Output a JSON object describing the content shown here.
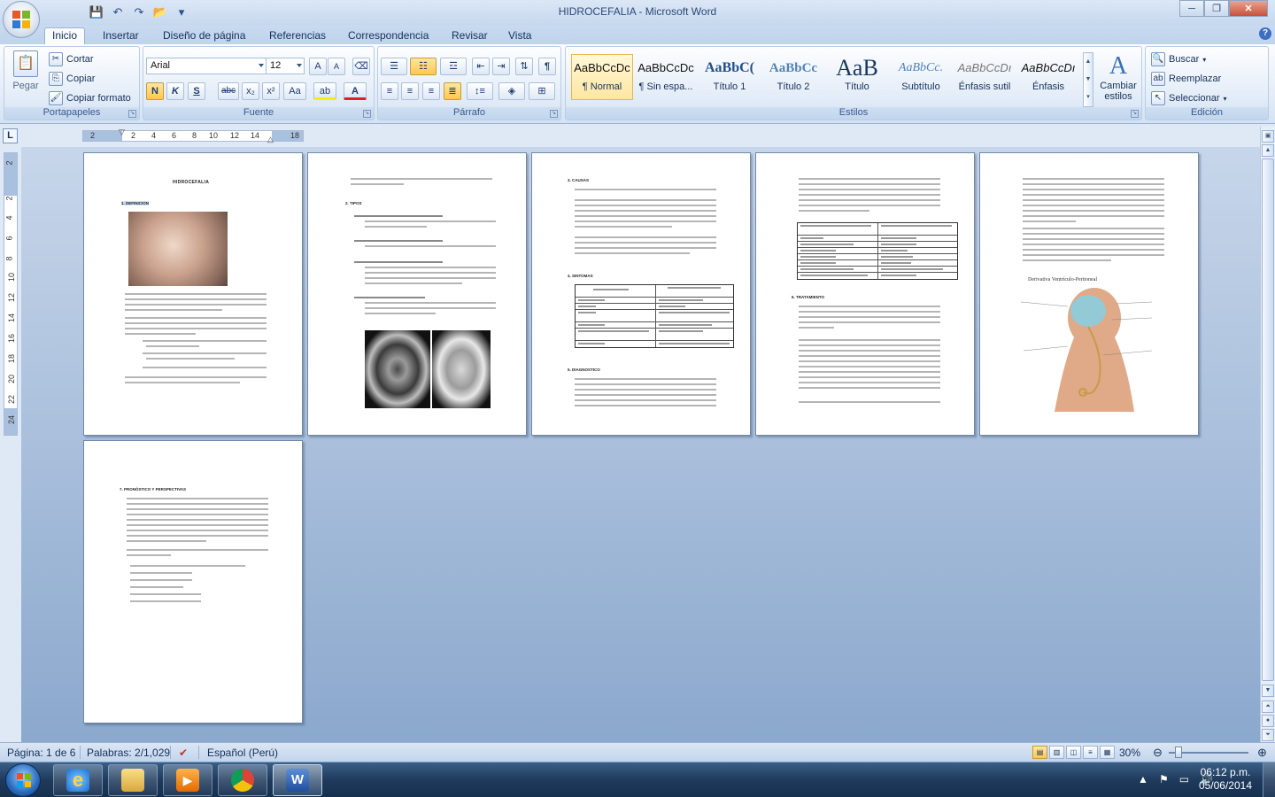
{
  "window": {
    "title": "HIDROCEFALIA - Microsoft Word",
    "minimize": "─",
    "maximize": "❐",
    "close": "✕"
  },
  "tabs": [
    "Inicio",
    "Insertar",
    "Diseño de página",
    "Referencias",
    "Correspondencia",
    "Revisar",
    "Vista"
  ],
  "help": "?",
  "clipboard": {
    "label": "Portapapeles",
    "paste": "Pegar",
    "cut": "Cortar",
    "copy": "Copiar",
    "format_painter": "Copiar formato"
  },
  "font": {
    "label": "Fuente",
    "family": "Arial",
    "size": "12",
    "grow": "A",
    "shrink": "A",
    "bold": "N",
    "italic": "K",
    "underline": "S",
    "strike": "abc",
    "sub": "x₂",
    "sup": "x²",
    "case": "Aa",
    "highlight": "ab",
    "color": "A"
  },
  "paragraph": {
    "label": "Párrafo",
    "pilcrow": "¶"
  },
  "styles": {
    "label": "Estilos",
    "items": [
      {
        "sample": "AaBbCcDc",
        "name": "¶ Normal"
      },
      {
        "sample": "AaBbCcDc",
        "name": "¶ Sin espa..."
      },
      {
        "sample": "AaBbC(",
        "name": "Título 1"
      },
      {
        "sample": "AaBbCc",
        "name": "Título 2"
      },
      {
        "sample": "AaB",
        "name": "Título"
      },
      {
        "sample": "AaBbCc.",
        "name": "Subtítulo"
      },
      {
        "sample": "AaBbCcDı",
        "name": "Énfasis sutil"
      },
      {
        "sample": "AaBbCcDı",
        "name": "Énfasis"
      }
    ],
    "change": "Cambiar",
    "change2": "estilos"
  },
  "editing": {
    "label": "Edición",
    "find": "Buscar",
    "replace": "Reemplazar",
    "select": "Seleccionar"
  },
  "ruler": {
    "h_numbers": [
      "2",
      "2",
      "4",
      "6",
      "8",
      "10",
      "12",
      "14",
      "18"
    ],
    "v_numbers": [
      "2",
      "2",
      "4",
      "6",
      "8",
      "10",
      "12",
      "14",
      "16",
      "18",
      "20",
      "22",
      "24"
    ]
  },
  "pages": {
    "p1_title": "HIDROCEFALIA",
    "p1_section": "1.  DEFINICION",
    "p2_section": "2.  TIPOS",
    "p3_section1": "3.  CAUSAS",
    "p3_section2": "4.  SINTOMAS",
    "p3_section3": "5.  DIAGNOSTICO",
    "p4_section": "6.  TRATAMIENTO",
    "p5_figure_caption": "Derivativa Ventrículo-Peritoneal",
    "p6_section": "7.  PRONÓSTICO Y PERSPECTIVAS"
  },
  "status": {
    "page": "Página: 1 de 6",
    "words": "Palabras: 2/1,029",
    "language": "Español (Perú)",
    "zoom": "30%"
  },
  "taskbar": {
    "time": "06:12 p.m.",
    "date": "05/06/2014"
  }
}
